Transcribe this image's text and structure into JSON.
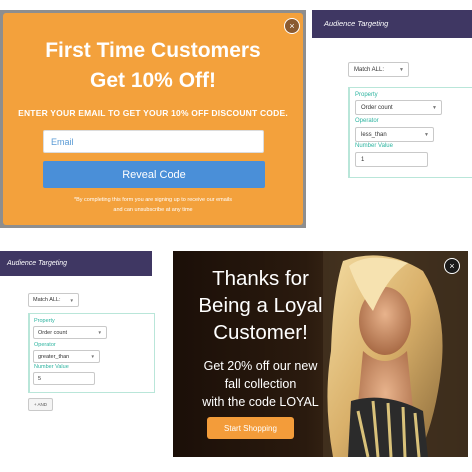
{
  "orange_popup": {
    "title_line1": "First Time Customers",
    "title_line2": "Get 10% Off!",
    "instruction": "ENTER YOUR EMAIL TO GET YOUR 10% OFF DISCOUNT CODE.",
    "email_placeholder": "Email",
    "button_label": "Reveal Code",
    "disclaimer_line1": "*By completing this form you are signing up to receive our emails",
    "disclaimer_line2": "and can unsubscribe at any time",
    "close_icon": "×",
    "colors": {
      "background": "#f3a13c",
      "button": "#4a8fd8"
    }
  },
  "targeting_top": {
    "header": "Audience Targeting",
    "match": "Match ALL:",
    "property_label": "Property",
    "property_value": "Order count",
    "operator_label": "Operator",
    "operator_value": "less_than",
    "number_label": "Number Value",
    "number_value": "1"
  },
  "targeting_bottom": {
    "header": "Audience Targeting",
    "match": "Match ALL:",
    "property_label": "Property",
    "property_value": "Order count",
    "operator_label": "Operator",
    "operator_value": "greater_than",
    "number_label": "Number Value",
    "number_value": "5",
    "add_button": "+ AND"
  },
  "loyal_popup": {
    "heading": [
      "Thanks for",
      "Being a Loyal",
      "Customer!"
    ],
    "offer": [
      "Get 20% off our new",
      "fall collection",
      "with the code LOYAL"
    ],
    "button_label": "Start Shopping",
    "close_icon": "×",
    "colors": {
      "button": "#f39c3a",
      "header": "#3f3763"
    }
  }
}
